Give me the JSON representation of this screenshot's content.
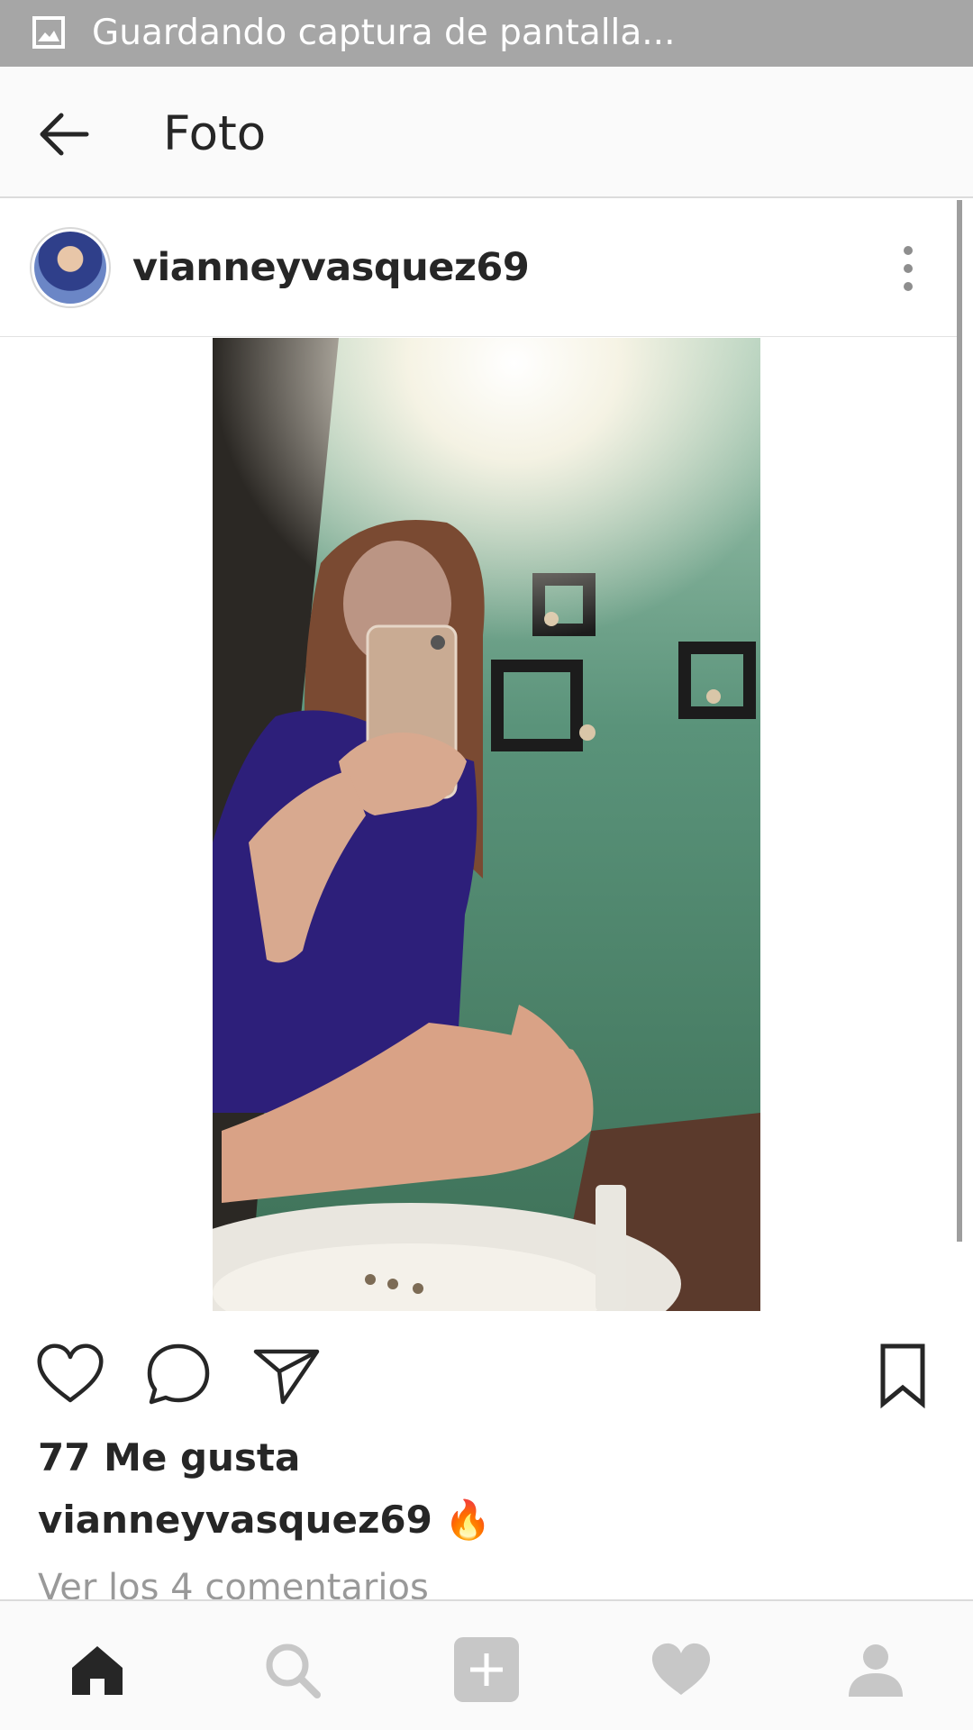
{
  "status_bar": {
    "text": "Guardando captura de pantalla...",
    "icon": "image-icon"
  },
  "app_bar": {
    "title": "Foto",
    "back_icon": "arrow-left-icon"
  },
  "post": {
    "username": "vianneyvasquez69",
    "more_icon": "more-vertical-icon",
    "photo_description": "mirror-selfie-photo",
    "likes_text": "77 Me gusta",
    "caption_username": "vianneyvasquez69",
    "caption_text": "🔥",
    "view_comments": "Ver los 4 comentarios",
    "actions": {
      "like_icon": "heart-outline-icon",
      "comment_icon": "comment-icon",
      "share_icon": "send-icon",
      "save_icon": "bookmark-icon"
    }
  },
  "bottom_nav": {
    "items": [
      {
        "icon": "home-icon",
        "active": true
      },
      {
        "icon": "search-icon",
        "active": false
      },
      {
        "icon": "add-icon",
        "active": false
      },
      {
        "icon": "heart-icon",
        "active": false
      },
      {
        "icon": "profile-icon",
        "active": false
      }
    ]
  },
  "colors": {
    "status_bar": "#a6a6a6",
    "app_bar": "#fafafa",
    "text": "#262626",
    "muted": "#999999",
    "nav_inactive": "#c7c7c7",
    "nav_active": "#262626"
  }
}
